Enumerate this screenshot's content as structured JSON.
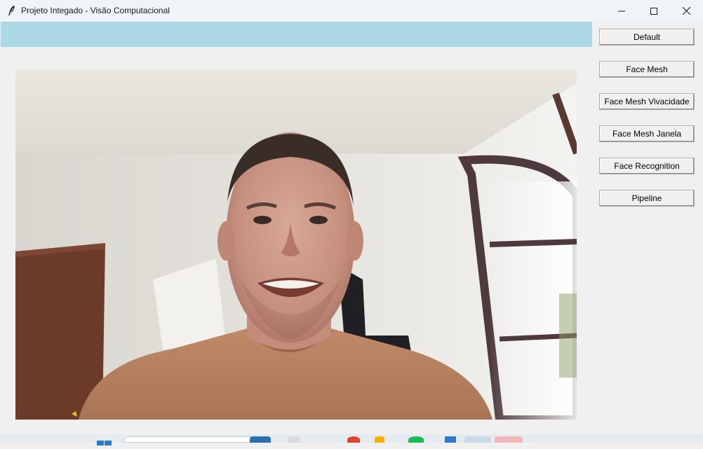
{
  "window": {
    "title": "Projeto Integado - Visão Computacional",
    "icon": "feather-icon",
    "controls": [
      "minimize-icon",
      "maximize-icon",
      "close-icon"
    ]
  },
  "status_bar": {
    "text": "",
    "color": "#add8e6"
  },
  "video": {
    "description_icon": "webcam-frame"
  },
  "sidebar": {
    "buttons": [
      {
        "label": "Default"
      },
      {
        "label": "Face Mesh"
      },
      {
        "label": "Face Mesh Vivacidade"
      },
      {
        "label": "Face Mesh Janela"
      },
      {
        "label": "Face Recognition"
      },
      {
        "label": "Pipeline"
      }
    ]
  }
}
